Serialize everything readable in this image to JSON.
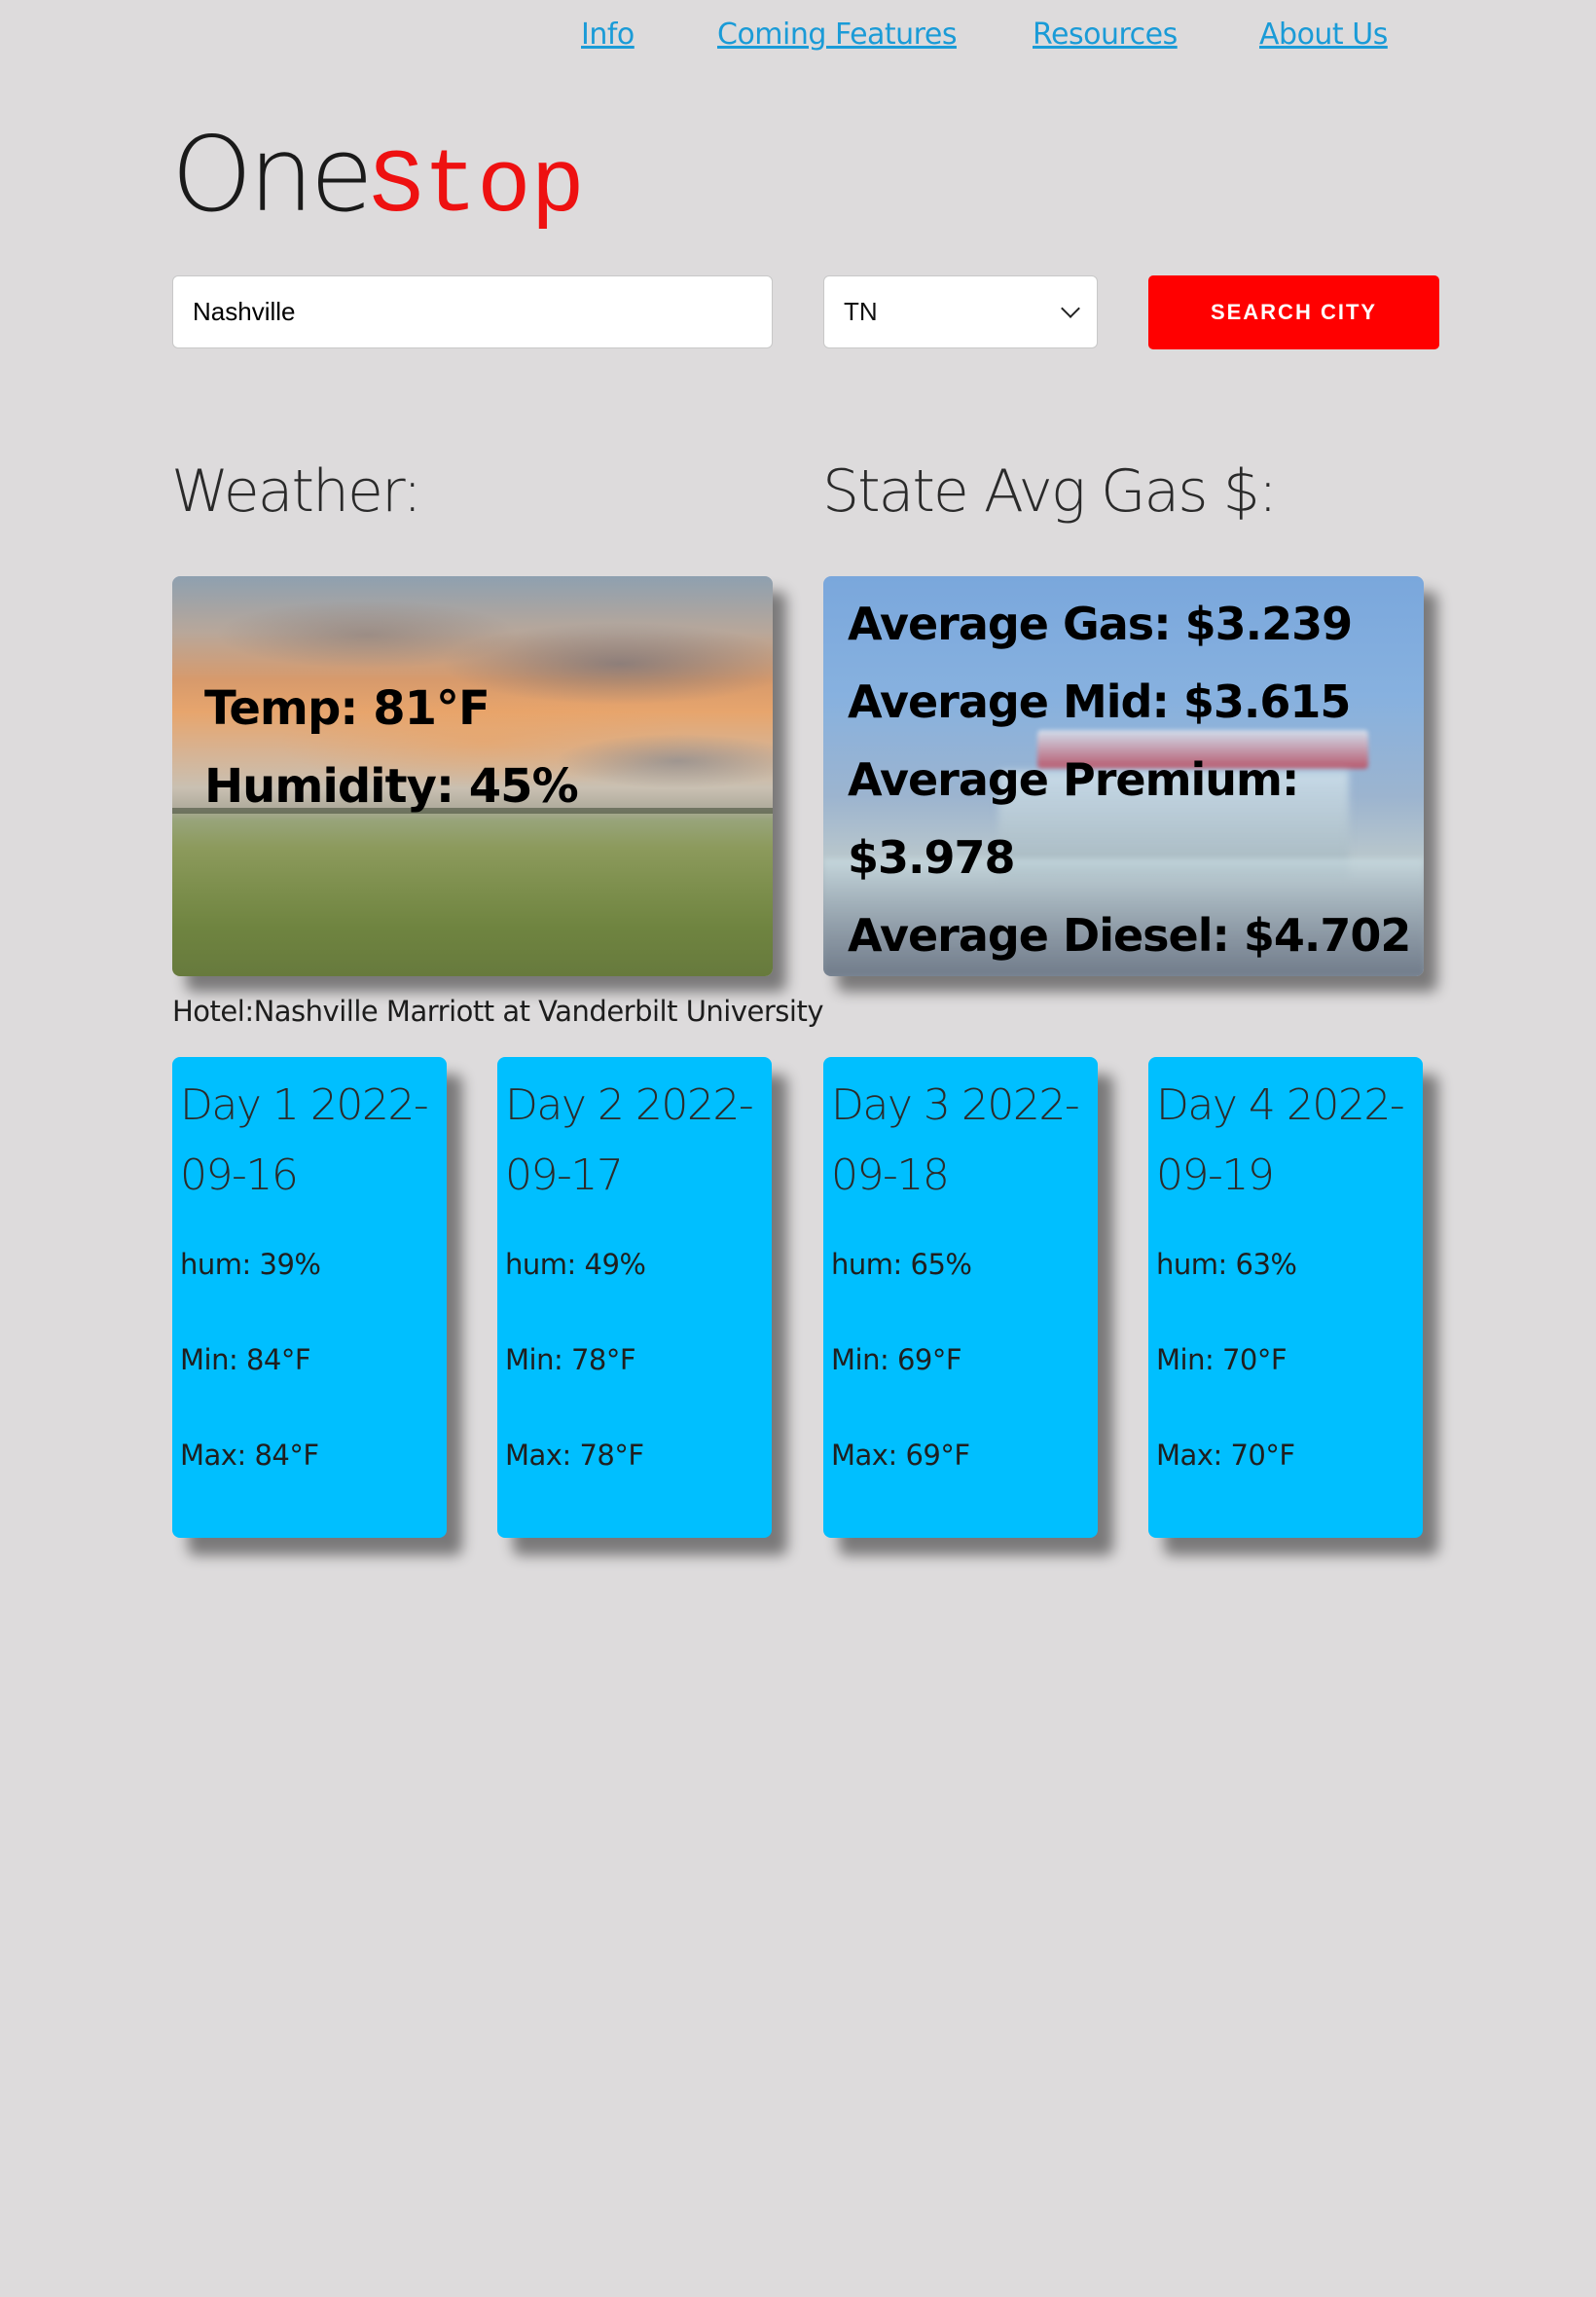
{
  "nav": {
    "items": [
      {
        "label": "Info"
      },
      {
        "label": "Coming Features"
      },
      {
        "label": "Resources"
      },
      {
        "label": "About Us"
      }
    ]
  },
  "logo": {
    "part1": "One",
    "part2": "Stop",
    "part2_color": "#ee1111"
  },
  "search": {
    "city_value": "Nashville",
    "state_value": "TN",
    "button_label": "SEARCH CITY",
    "button_color": "#ff0000"
  },
  "weather": {
    "heading": "Weather:",
    "temp": "Temp: 81°F",
    "humidity": "Humidity: 45%"
  },
  "gas": {
    "heading": "State Avg Gas $:",
    "regular": "Average Gas: $3.239",
    "mid": "Average Mid: $3.615",
    "premium_label": "Average Premium:",
    "premium_value": "$3.978",
    "diesel": "Average Diesel: $4.702"
  },
  "hotel": "Hotel:Nashville Marriott at Vanderbilt University",
  "forecast": [
    {
      "title": "Day 1 2022-09-16",
      "hum": "hum: 39%",
      "min": "Min: 84°F",
      "max": "Max: 84°F"
    },
    {
      "title": "Day 2 2022-09-17",
      "hum": "hum: 49%",
      "min": "Min: 78°F",
      "max": "Max: 78°F"
    },
    {
      "title": "Day 3 2022-09-18",
      "hum": "hum: 65%",
      "min": "Min: 69°F",
      "max": "Max: 69°F"
    },
    {
      "title": "Day 4 2022-09-19",
      "hum": "hum: 63%",
      "min": "Min: 70°F",
      "max": "Max: 70°F"
    }
  ],
  "colors": {
    "background": "#dddbdc",
    "link": "#1a9bd7",
    "forecast_card": "#00bfff",
    "accent_red": "#ff0000"
  }
}
